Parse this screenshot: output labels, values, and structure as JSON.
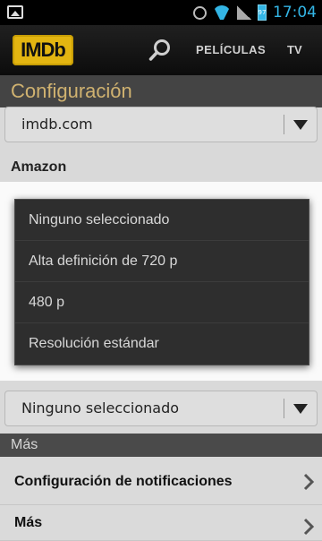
{
  "status_bar": {
    "time": "17:04",
    "battery": "97"
  },
  "header": {
    "logo_text": "IMDb",
    "nav": [
      {
        "label": "PELÍCULAS"
      },
      {
        "label": "TV"
      }
    ]
  },
  "page_title": "Configuración",
  "top_select": {
    "value": "imdb.com"
  },
  "amazon": {
    "label": "Amazon"
  },
  "popup": {
    "options": [
      {
        "label": "Ninguno seleccionado"
      },
      {
        "label": "Alta definición de 720 p"
      },
      {
        "label": "480 p"
      },
      {
        "label": "Resolución estándar"
      }
    ]
  },
  "bottom_select": {
    "value": "Ninguno seleccionado"
  },
  "mas_section": {
    "header": "Más",
    "items": [
      {
        "label": "Configuración de notificaciones"
      },
      {
        "label": "Más"
      }
    ]
  },
  "colors": {
    "accent": "#33b5e5",
    "brand": "#e3b511",
    "title": "#d0b270"
  }
}
